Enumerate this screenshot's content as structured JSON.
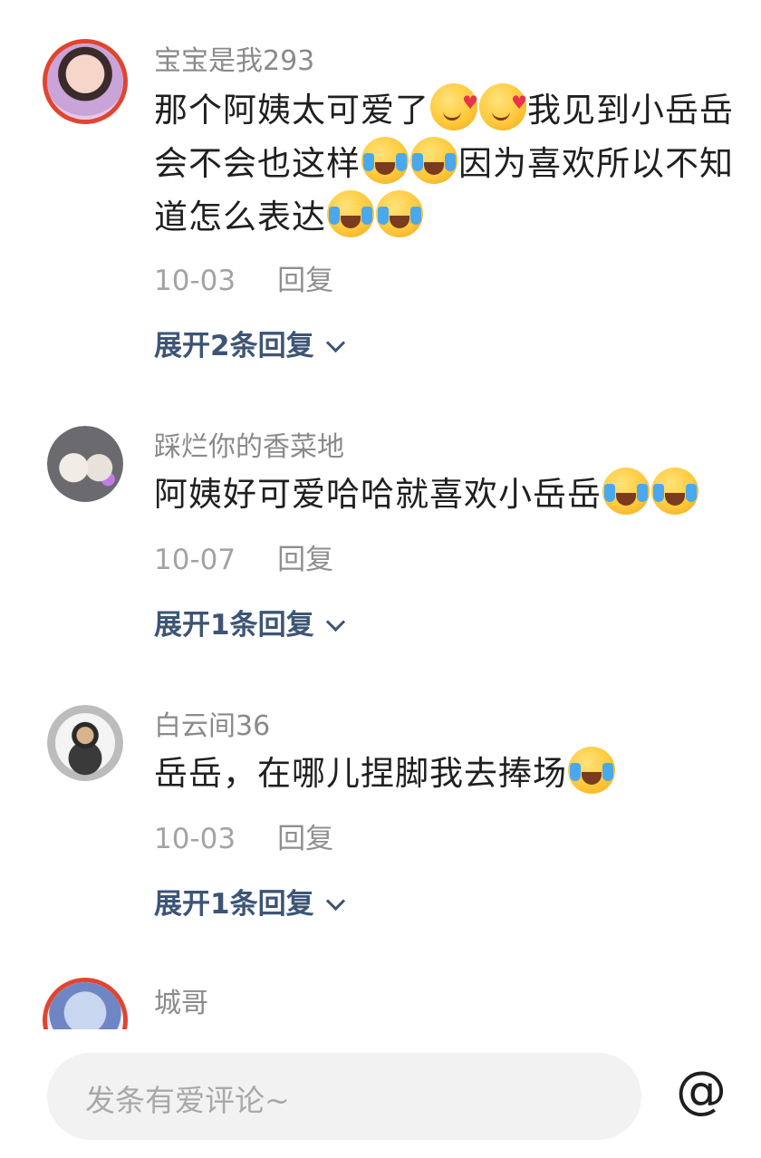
{
  "comments": [
    {
      "username": "宝宝是我293",
      "text_parts": [
        "那个阿姨太可爱了",
        "我见到小岳岳会不会也这样",
        "因为喜欢所以不知道怎么表达"
      ],
      "emoji": [
        "heart-eyes-smile-icon",
        "crying-laughing-icon"
      ],
      "date": "10-03",
      "reply_label": "回复",
      "expand_label": "展开2条回复"
    },
    {
      "username": "踩烂你的香菜地",
      "text_parts": [
        "阿姨好可爱哈哈就喜欢小岳岳"
      ],
      "emoji": [
        "crying-laughing-icon"
      ],
      "date": "10-07",
      "reply_label": "回复",
      "expand_label": "展开1条回复"
    },
    {
      "username": "白云间36",
      "text_parts": [
        "岳岳，在哪儿捏脚我去捧场"
      ],
      "emoji": [
        "crying-laughing-icon"
      ],
      "date": "10-03",
      "reply_label": "回复",
      "expand_label": "展开1条回复"
    },
    {
      "username": "城哥"
    }
  ],
  "composer": {
    "placeholder": "发条有爱评论~",
    "mention_symbol": "@"
  },
  "colors": {
    "username": "#8a8a8a",
    "expand_link": "#3d5575",
    "input_bg": "#f2f2f2"
  }
}
